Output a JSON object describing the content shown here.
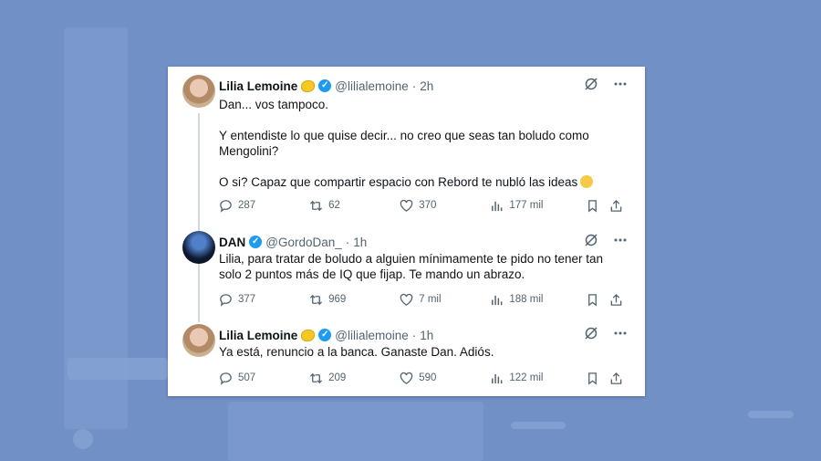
{
  "tweets": [
    {
      "name": "Lilia Lemoine",
      "has_lemon": true,
      "handle": "@lilialemoine",
      "dot": "·",
      "time": "2h",
      "paragraphs": [
        "Dan... vos tampoco.",
        "Y entendiste lo que quise decir... no creo que seas tan boludo como Mengolini?",
        "O si? Capaz que compartir espacio con Rebord te nubló las ideas"
      ],
      "replies": "287",
      "retweets": "62",
      "likes": "370",
      "views": "177 mil"
    },
    {
      "name": "DAN",
      "has_lemon": false,
      "handle": "@GordoDan_",
      "dot": "·",
      "time": "1h",
      "paragraphs": [
        "Lilia, para tratar de boludo a alguien mínimamente te pido no tener tan solo 2 puntos más de IQ que fijap. Te mando un abrazo."
      ],
      "replies": "377",
      "retweets": "969",
      "likes": "7 mil",
      "views": "188 mil"
    },
    {
      "name": "Lilia Lemoine",
      "has_lemon": true,
      "handle": "@lilialemoine",
      "dot": "·",
      "time": "1h",
      "paragraphs": [
        "Ya está, renuncio a la banca. Ganaste Dan. Adiós."
      ],
      "replies": "507",
      "retweets": "209",
      "likes": "590",
      "views": "122 mil"
    }
  ],
  "colors": {
    "background": "#6f8fc4",
    "verified": "#1d9bf0",
    "text": "#0f1419",
    "muted": "#536471"
  }
}
